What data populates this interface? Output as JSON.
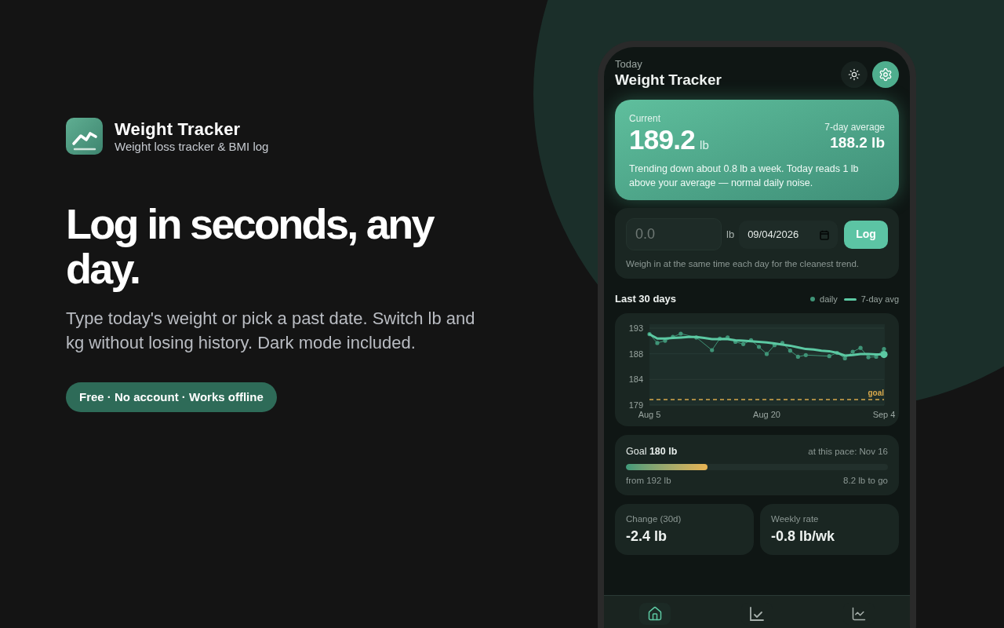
{
  "brand": {
    "name": "Weight Tracker",
    "tagline": "Weight loss tracker & BMI log"
  },
  "hero": {
    "headline": "Log in seconds, any day.",
    "body": "Type today's weight or pick a past date. Switch lb and kg without losing history. Dark mode included.",
    "pill": "Free · No account · Works offline"
  },
  "phone": {
    "header": {
      "eyebrow": "Today",
      "title": "Weight Tracker"
    },
    "summary": {
      "current_label": "Current",
      "current_value": "189.2",
      "current_unit": "lb",
      "average_label": "7-day average",
      "average_value": "188.2 lb",
      "note": "Trending down about 0.8 lb a week. Today reads 1 lb above your average — normal daily noise."
    },
    "log_form": {
      "weight_placeholder": "0.0",
      "unit": "lb",
      "date_value": "09/04/2026",
      "button": "Log",
      "hint": "Weigh in at the same time each day for the cleanest trend."
    },
    "chart": {
      "chart_data": {
        "type": "line",
        "title": "Last 30 days",
        "categories": [
          "Aug 5",
          null,
          null,
          null,
          null,
          null,
          null,
          null,
          null,
          null,
          null,
          null,
          null,
          null,
          null,
          "Aug 20",
          null,
          null,
          null,
          null,
          null,
          null,
          null,
          null,
          null,
          null,
          null,
          null,
          null,
          null,
          "Sep 4"
        ],
        "ylim": [
          179,
          193
        ],
        "yticks": [
          {
            "value": 193,
            "label": "193"
          },
          {
            "value": 188.33,
            "label": "188"
          },
          {
            "value": 183.67,
            "label": "184"
          },
          {
            "value": 179,
            "label": "179"
          }
        ],
        "series": [
          {
            "name": "daily",
            "color": "#3f9477",
            "values": [
              191.9,
              190.3,
              190.7,
              191.4,
              192.0,
              null,
              191.3,
              null,
              189.0,
              191.1,
              191.3,
              190.5,
              190.1,
              190.8,
              189.6,
              188.3,
              189.9,
              190.3,
              188.9,
              187.8,
              188.1,
              null,
              null,
              187.9,
              188.5,
              187.5,
              188.7,
              189.4,
              187.7,
              187.8,
              189.2
            ]
          },
          {
            "name": "7-day avg",
            "color": "#5cc9a3",
            "values": [
              191.9,
              191.1,
              191.1,
              191.2,
              191.3,
              191.4,
              191.4,
              191.2,
              191.0,
              191.0,
              191.0,
              190.8,
              190.7,
              190.6,
              190.5,
              190.4,
              190.2,
              190.0,
              189.8,
              189.5,
              189.2,
              189.1,
              188.9,
              188.8,
              188.5,
              188.0,
              188.1,
              188.3,
              188.3,
              188.2,
              188.2
            ]
          }
        ],
        "ref_lines": [
          {
            "axis": "y",
            "value": 180,
            "label": "goal"
          }
        ]
      }
    },
    "goal": {
      "label": "Goal **180 lb**",
      "eta": "at this pace: Nov 16",
      "level": 0.31,
      "start": "from 192 lb",
      "remaining": "8.2 lb to go"
    },
    "stats": [
      {
        "label": "Change (30d)",
        "value": "-2.4 lb"
      },
      {
        "label": "Weekly rate",
        "value": "-0.8 lb/wk"
      }
    ],
    "nav": [
      {
        "selected": true
      },
      {
        "selected": false
      },
      {
        "selected": false
      }
    ]
  }
}
